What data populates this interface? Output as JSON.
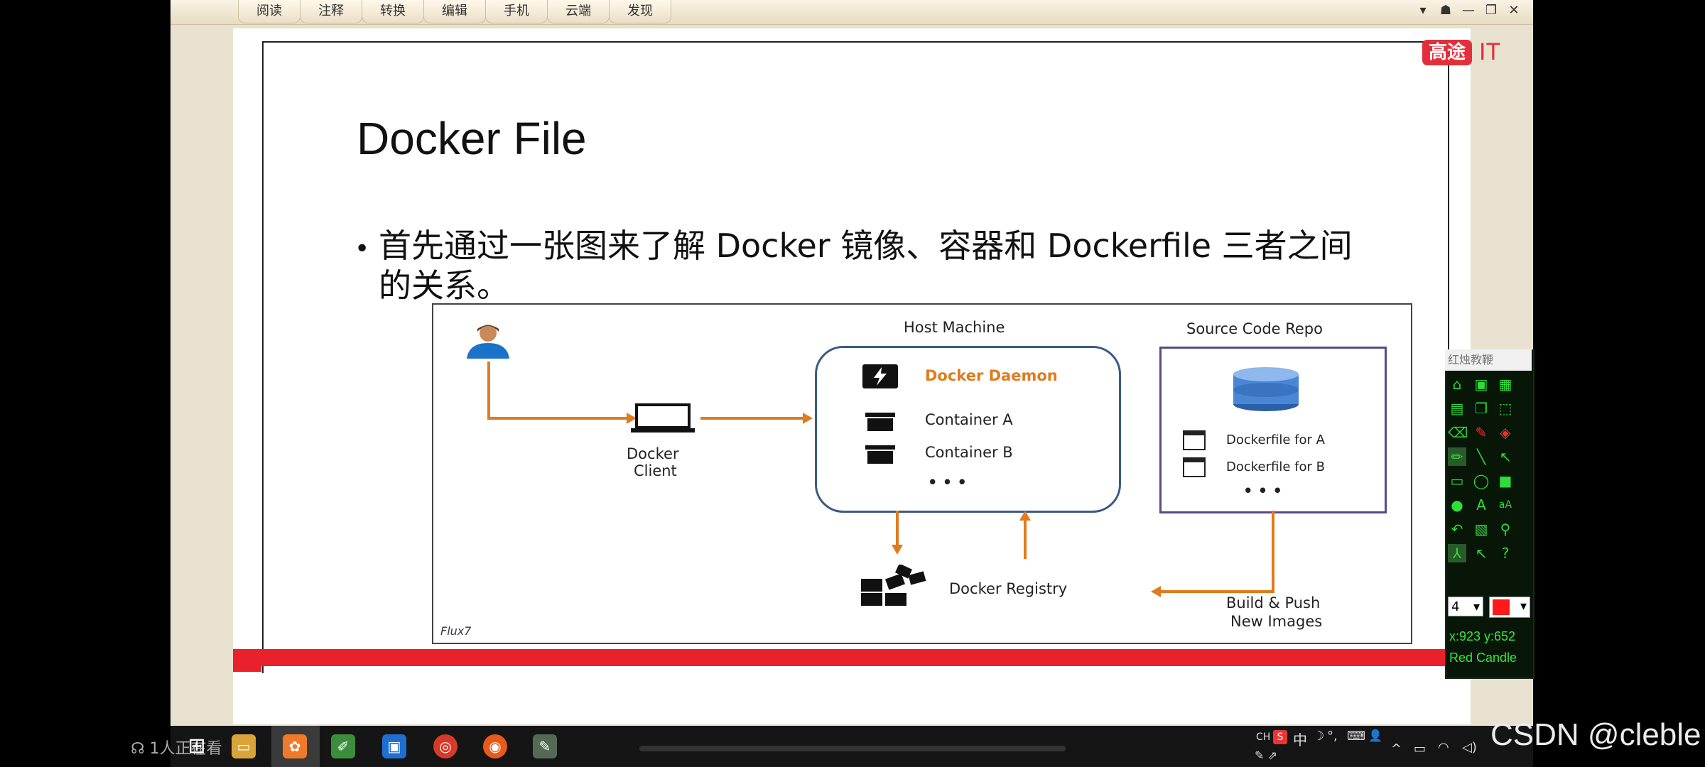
{
  "menu": [
    "阅读",
    "注释",
    "转换",
    "编辑",
    "手机",
    "云端",
    "发现"
  ],
  "window_controls": [
    "▾",
    "☗",
    "—",
    "❐",
    "✕"
  ],
  "brand": {
    "box": "高途",
    "suffix": "IT"
  },
  "slide": {
    "title": "Docker File",
    "bullet": "首先通过一张图来了解 Docker 镜像、容器和 Dockerfile 三者之间的关系。"
  },
  "diagram": {
    "host_machine": "Host Machine",
    "source_repo": "Source Code Repo",
    "docker_client_1": "Docker",
    "docker_client_2": "Client",
    "docker_daemon": "Docker Daemon",
    "container_a": "Container A",
    "container_b": "Container B",
    "ellipsis": "• • •",
    "dockerfile_a": "Dockerfile for A",
    "dockerfile_b": "Dockerfile for B",
    "docker_registry": "Docker Registry",
    "build_push_1": "Build & Push",
    "build_push_2": "New Images",
    "watermark": "Flux7"
  },
  "pen_tool": {
    "title": "红烛教鞭",
    "size": "4",
    "coords": "x:923  y:652",
    "name": "Red Candle",
    "color": "#ff1a1a"
  },
  "taskbar": {
    "watching": "1人正在看",
    "tray": [
      "CH",
      "中",
      "☽",
      "°,",
      "⌨",
      "👤"
    ]
  },
  "watermark_csdn": "CSDN @cleble",
  "colors": {
    "accent_orange": "#e07b1e",
    "brand_red": "#e22f3b",
    "bar_red": "#e8212c",
    "pen_green": "#2edc3b"
  }
}
